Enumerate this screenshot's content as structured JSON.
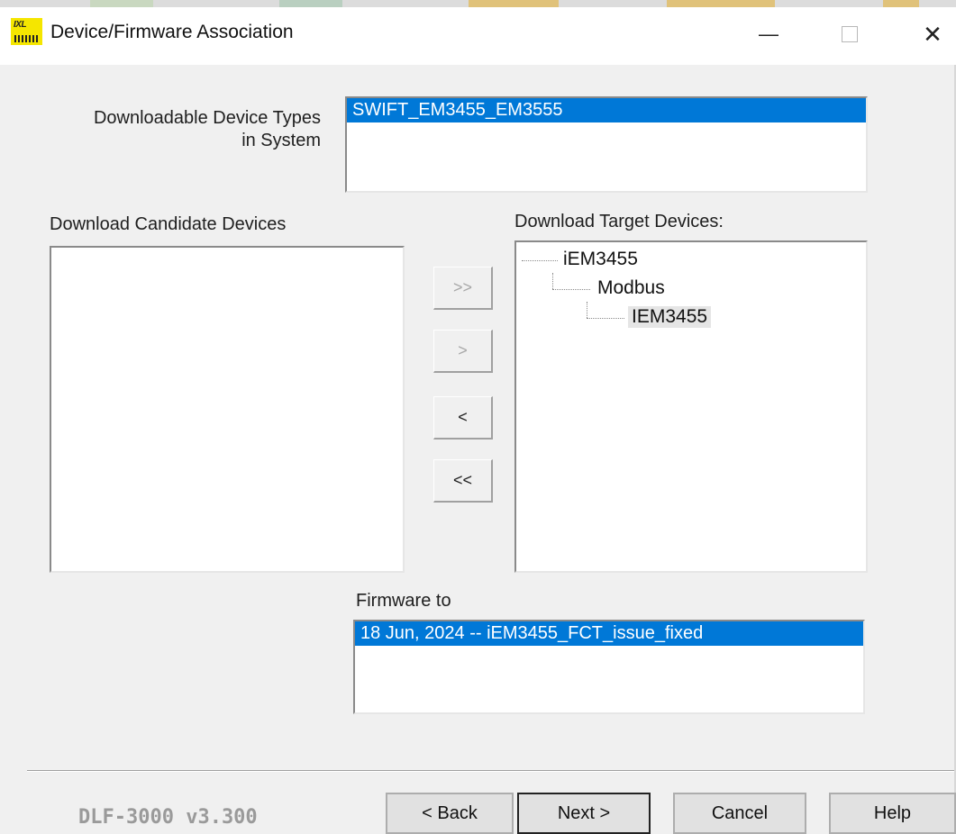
{
  "window": {
    "title": "Device/Firmware Association",
    "icon": "app-logo-icon",
    "icon_text": "IXL",
    "controls": {
      "minimize": "—",
      "maximize": "☐",
      "close": "✕"
    }
  },
  "device_types": {
    "label_line1": "Downloadable Device Types",
    "label_line2": "in System",
    "items": [
      "SWIFT_EM3455_EM3555"
    ],
    "selected_index": 0
  },
  "candidates": {
    "label": "Download Candidate Devices",
    "items": []
  },
  "transfer_buttons": {
    "add_all": ">>",
    "add": ">",
    "remove": "<",
    "remove_all": "<<"
  },
  "targets": {
    "label": "Download Target Devices:",
    "tree": {
      "root": "iEM3455",
      "child": "Modbus",
      "leaf": "IEM3455"
    }
  },
  "firmware": {
    "label": "Firmware to",
    "items": [
      "18 Jun, 2024 -- iEM3455_FCT_issue_fixed"
    ],
    "selected_index": 0
  },
  "footer": {
    "version": "DLF-3000 v3.300",
    "back": "< Back",
    "next": "Next >",
    "cancel": "Cancel",
    "help": "Help"
  },
  "colors": {
    "selection": "#0078d7",
    "icon_bg": "#f5e600",
    "dialog_bg": "#f0f0f0"
  }
}
